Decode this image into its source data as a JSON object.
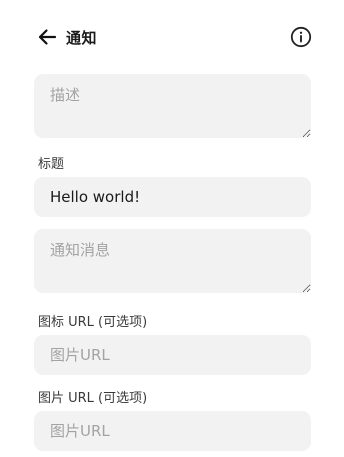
{
  "header": {
    "back_icon": "arrow-left-icon",
    "title": "通知",
    "info_icon": "info-circle-icon"
  },
  "form": {
    "description": {
      "placeholder": "描述",
      "value": ""
    },
    "title": {
      "label": "标题",
      "value": "Hello world!"
    },
    "message": {
      "placeholder": "通知消息",
      "value": ""
    },
    "icon_url": {
      "label": "图标 URL (可选项)",
      "placeholder": "图片URL",
      "value": ""
    },
    "image_url": {
      "label": "图片 URL (可选项)",
      "placeholder": "图片URL",
      "value": ""
    }
  }
}
